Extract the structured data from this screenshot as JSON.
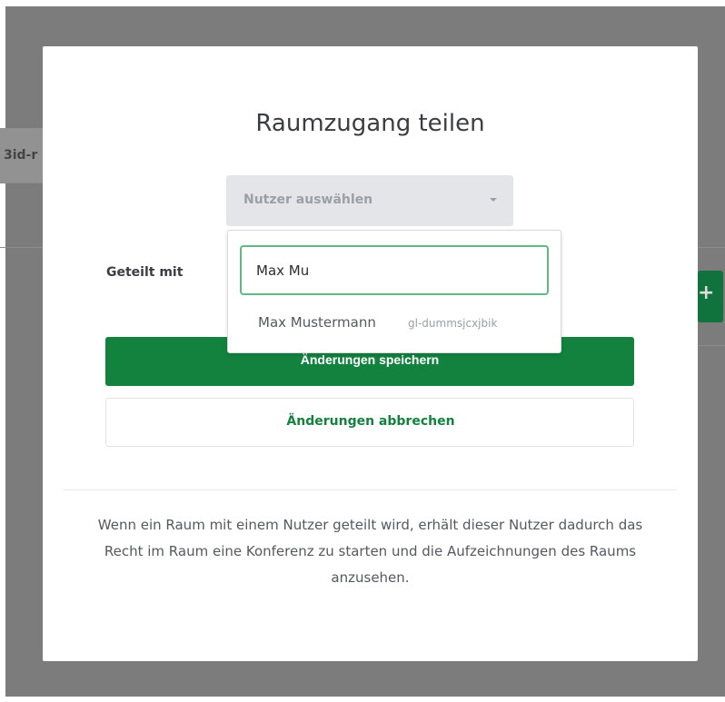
{
  "background": {
    "tab_fragment": "3id-r"
  },
  "modal": {
    "title": "Raumzugang teilen",
    "user_select": {
      "placeholder": "Nutzer auswählen"
    },
    "shared_with_label": "Geteilt mit",
    "dropdown": {
      "search_value": "Max Mu",
      "options": [
        {
          "name": "Max Mustermann",
          "id": "gl-dummsjcxjbik"
        }
      ]
    },
    "save_label": "Änderungen speichern",
    "cancel_label": "Änderungen abbrechen",
    "help_text": "Wenn ein Raum mit einem Nutzer geteilt wird, erhält dieser Nutzer dadurch das Recht im Raum eine Konferenz zu starten und die Aufzeichnungen des Raums anzusehen."
  },
  "colors": {
    "primary": "#13823f",
    "focus_border": "#5fb886",
    "backdrop": "#7c7c7c"
  }
}
